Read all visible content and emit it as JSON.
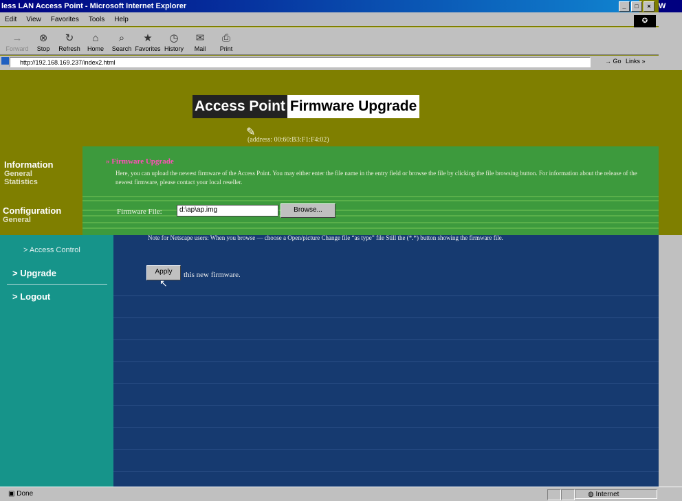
{
  "window": {
    "title": "less LAN Access Point - Microsoft Internet Explorer",
    "side_title": "W"
  },
  "menu": [
    "Edit",
    "View",
    "Favorites",
    "Tools",
    "Help"
  ],
  "toolbar": [
    {
      "label": "Forward",
      "icon": "→",
      "disabled": true
    },
    {
      "label": "Stop",
      "icon": "⊗"
    },
    {
      "label": "Refresh",
      "icon": "↻"
    },
    {
      "label": "Home",
      "icon": "⌂"
    },
    {
      "label": "Search",
      "icon": "⌕"
    },
    {
      "label": "Favorites",
      "icon": "★"
    },
    {
      "label": "History",
      "icon": "◷"
    },
    {
      "label": "Mail",
      "icon": "✉"
    },
    {
      "label": "Print",
      "icon": "⎙"
    }
  ],
  "address": {
    "url": "http://192.168.169.237/index2.html",
    "go": "Go",
    "links": "Links"
  },
  "header": {
    "part1": "Access Point",
    "part2": "Firmware Upgrade"
  },
  "device": {
    "address_text": "(address: 00:60:B3:F1:F4:02)"
  },
  "nav": {
    "information": "Information",
    "general": "General",
    "statistics": "Statistics",
    "configuration": "Configuration",
    "config_general": "General",
    "access_control": "> Access Control",
    "upgrade": "> Upgrade",
    "logout": "> Logout"
  },
  "firmware": {
    "section_title": "Firmware Upgrade",
    "description": "Here, you can upload the newest firmware of the Access Point. You may either enter the file name in the entry field or browse the file by clicking the file browsing button. For information about the release of the newest firmware, please contact your local reseller.",
    "file_label": "Firmware File:",
    "file_value": "d:\\ap\\ap.img",
    "browse": "Browse...",
    "note": "Note for Netscape users: When you browse — choose a Open/picture Change file “as type” file Still the (*.*) button showing the firmware file.",
    "apply": "Apply",
    "apply_suffix": "this new firmware."
  },
  "status": {
    "left": "Done",
    "zone": "Internet"
  }
}
